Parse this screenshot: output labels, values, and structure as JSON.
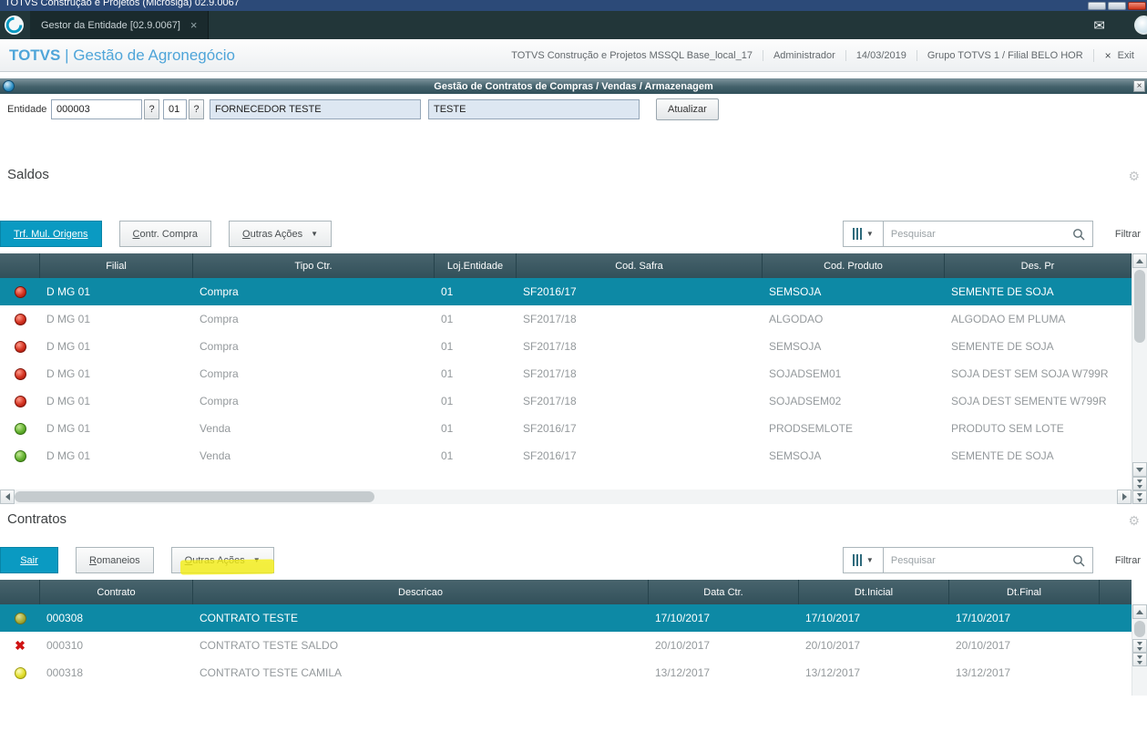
{
  "window": {
    "title": "TOTVS Construção e Projetos (Microsiga) 02.9.0067"
  },
  "tabs": {
    "active": "Gestor da Entidade [02.9.0067]",
    "close": "×"
  },
  "header": {
    "brand_totvs": "TOTVS",
    "brand_sep": "|",
    "brand_module": "Gestão de Agronegócio",
    "environment": "TOTVS Construção e Projetos MSSQL Base_local_17",
    "user": "Administrador",
    "date": "14/03/2019",
    "group_branch": "Grupo TOTVS 1 / Filial BELO HOR",
    "exit_icon": "×",
    "exit_label": "Exit"
  },
  "panel": {
    "title": "Gestão de Contratos de Compras / Vendas / Armazenagem",
    "close": "×"
  },
  "entity_form": {
    "label": "Entidade",
    "code": "000003",
    "help1": "?",
    "store": "01",
    "help2": "?",
    "name": "FORNECEDOR TESTE",
    "short_name": "TESTE",
    "refresh_button": "Atualizar"
  },
  "icons": {
    "gear": "⚙",
    "envelope": "✉",
    "dropdown_arrow": "▼",
    "red_x": "✖"
  },
  "saldos": {
    "title": "Saldos",
    "toolbar": {
      "trf_button": "Trf. Mul. Origens",
      "contr_button": "Contr. Compra",
      "outras_button": "Outras Ações",
      "search_placeholder": "Pesquisar",
      "filter_label": "Filtrar"
    },
    "columns": [
      "Filial",
      "Tipo Ctr.",
      "Loj.Entidade",
      "Cod. Safra",
      "Cod. Produto",
      "Des. Pr"
    ],
    "rows": [
      {
        "status": "red",
        "selected": true,
        "filial": "D MG 01",
        "tipo": "Compra",
        "loja": "01",
        "safra": "SF2016/17",
        "produto": "SEMSOJA",
        "descricao": "SEMENTE DE SOJA"
      },
      {
        "status": "red",
        "selected": false,
        "filial": "D MG 01",
        "tipo": "Compra",
        "loja": "01",
        "safra": "SF2017/18",
        "produto": "ALGODAO",
        "descricao": "ALGODAO EM PLUMA"
      },
      {
        "status": "red",
        "selected": false,
        "filial": "D MG 01",
        "tipo": "Compra",
        "loja": "01",
        "safra": "SF2017/18",
        "produto": "SEMSOJA",
        "descricao": "SEMENTE DE SOJA"
      },
      {
        "status": "red",
        "selected": false,
        "filial": "D MG 01",
        "tipo": "Compra",
        "loja": "01",
        "safra": "SF2017/18",
        "produto": "SOJADSEM01",
        "descricao": "SOJA DEST SEM SOJA W799R"
      },
      {
        "status": "red",
        "selected": false,
        "filial": "D MG 01",
        "tipo": "Compra",
        "loja": "01",
        "safra": "SF2017/18",
        "produto": "SOJADSEM02",
        "descricao": "SOJA DEST SEMENTE W799R"
      },
      {
        "status": "green",
        "selected": false,
        "filial": "D MG 01",
        "tipo": "Venda",
        "loja": "01",
        "safra": "SF2016/17",
        "produto": "PRODSEMLOTE",
        "descricao": "PRODUTO SEM LOTE"
      },
      {
        "status": "green",
        "selected": false,
        "filial": "D MG 01",
        "tipo": "Venda",
        "loja": "01",
        "safra": "SF2016/17",
        "produto": "SEMSOJA",
        "descricao": "SEMENTE DE SOJA"
      }
    ]
  },
  "contratos": {
    "title": "Contratos",
    "toolbar": {
      "sair_button": "Sair",
      "romaneios_button": "Romaneios",
      "outras_button": "Outras Ações",
      "search_placeholder": "Pesquisar",
      "filter_label": "Filtrar"
    },
    "columns": [
      "Contrato",
      "Descricao",
      "Data Ctr.",
      "Dt.Inicial",
      "Dt.Final"
    ],
    "rows": [
      {
        "status": "olive",
        "selected": true,
        "contrato": "000308",
        "descricao": "CONTRATO TESTE",
        "data_ctr": "17/10/2017",
        "dt_inicial": "17/10/2017",
        "dt_final": "17/10/2017"
      },
      {
        "status": "red-x",
        "selected": false,
        "contrato": "000310",
        "descricao": "CONTRATO TESTE SALDO",
        "data_ctr": "20/10/2017",
        "dt_inicial": "20/10/2017",
        "dt_final": "20/10/2017"
      },
      {
        "status": "yellow",
        "selected": false,
        "contrato": "000318",
        "descricao": "CONTRATO TESTE CAMILA",
        "data_ctr": "13/12/2017",
        "dt_inicial": "13/12/2017",
        "dt_final": "13/12/2017"
      }
    ]
  },
  "colors": {
    "accent_teal": "#0a9ac2",
    "selected_row": "#0d89a5",
    "grid_header": "#32505a",
    "status_red": "#d3311f",
    "status_green": "#64b231",
    "status_olive": "#a8ad39",
    "status_yellow": "#e3df2e",
    "highlight_yellow": "#f4ee12"
  }
}
